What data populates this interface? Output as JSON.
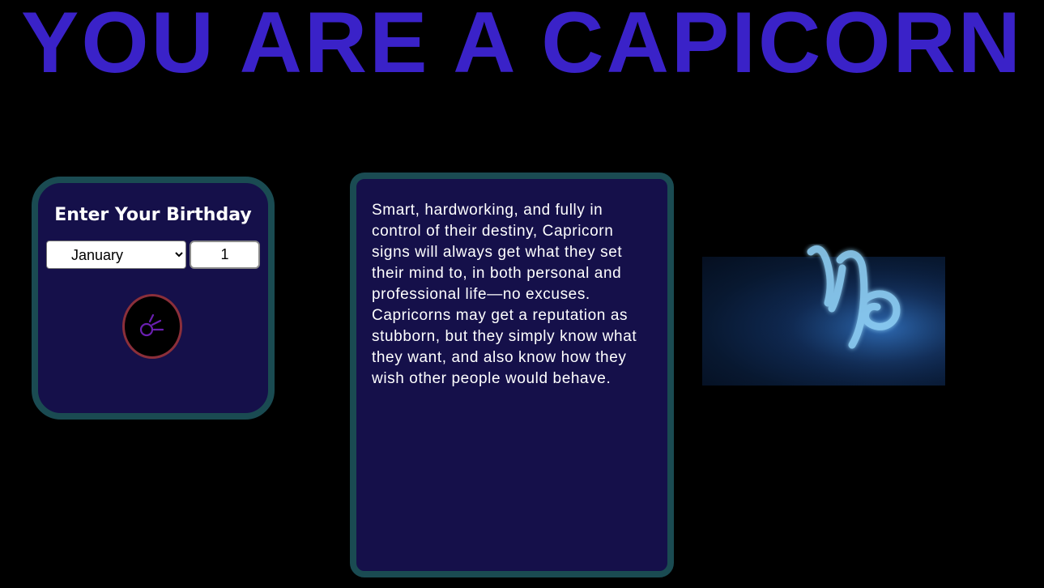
{
  "headline": "YOU ARE A CAPICORN",
  "birthday_form": {
    "title": "Enter Your Birthday",
    "month_selected": "January",
    "day_value": "1",
    "submit_icon": "comet-icon"
  },
  "description": {
    "text": "Smart, hardworking, and fully in control of their destiny, Capricorn signs will always get what they set their mind to, in both personal and professional life—no excuses. Capricorns may get a reputation as stubborn, but they simply know what they want, and also know how they wish other people would behave."
  },
  "zodiac_image": {
    "icon": "capricorn-symbol-icon"
  },
  "colors": {
    "background": "#000000",
    "headline": "#3a22c8",
    "card_background": "#15104a",
    "card_border": "#1a4b52",
    "button_border": "#8b2f3a",
    "icon_purple": "#6a1fb0"
  }
}
